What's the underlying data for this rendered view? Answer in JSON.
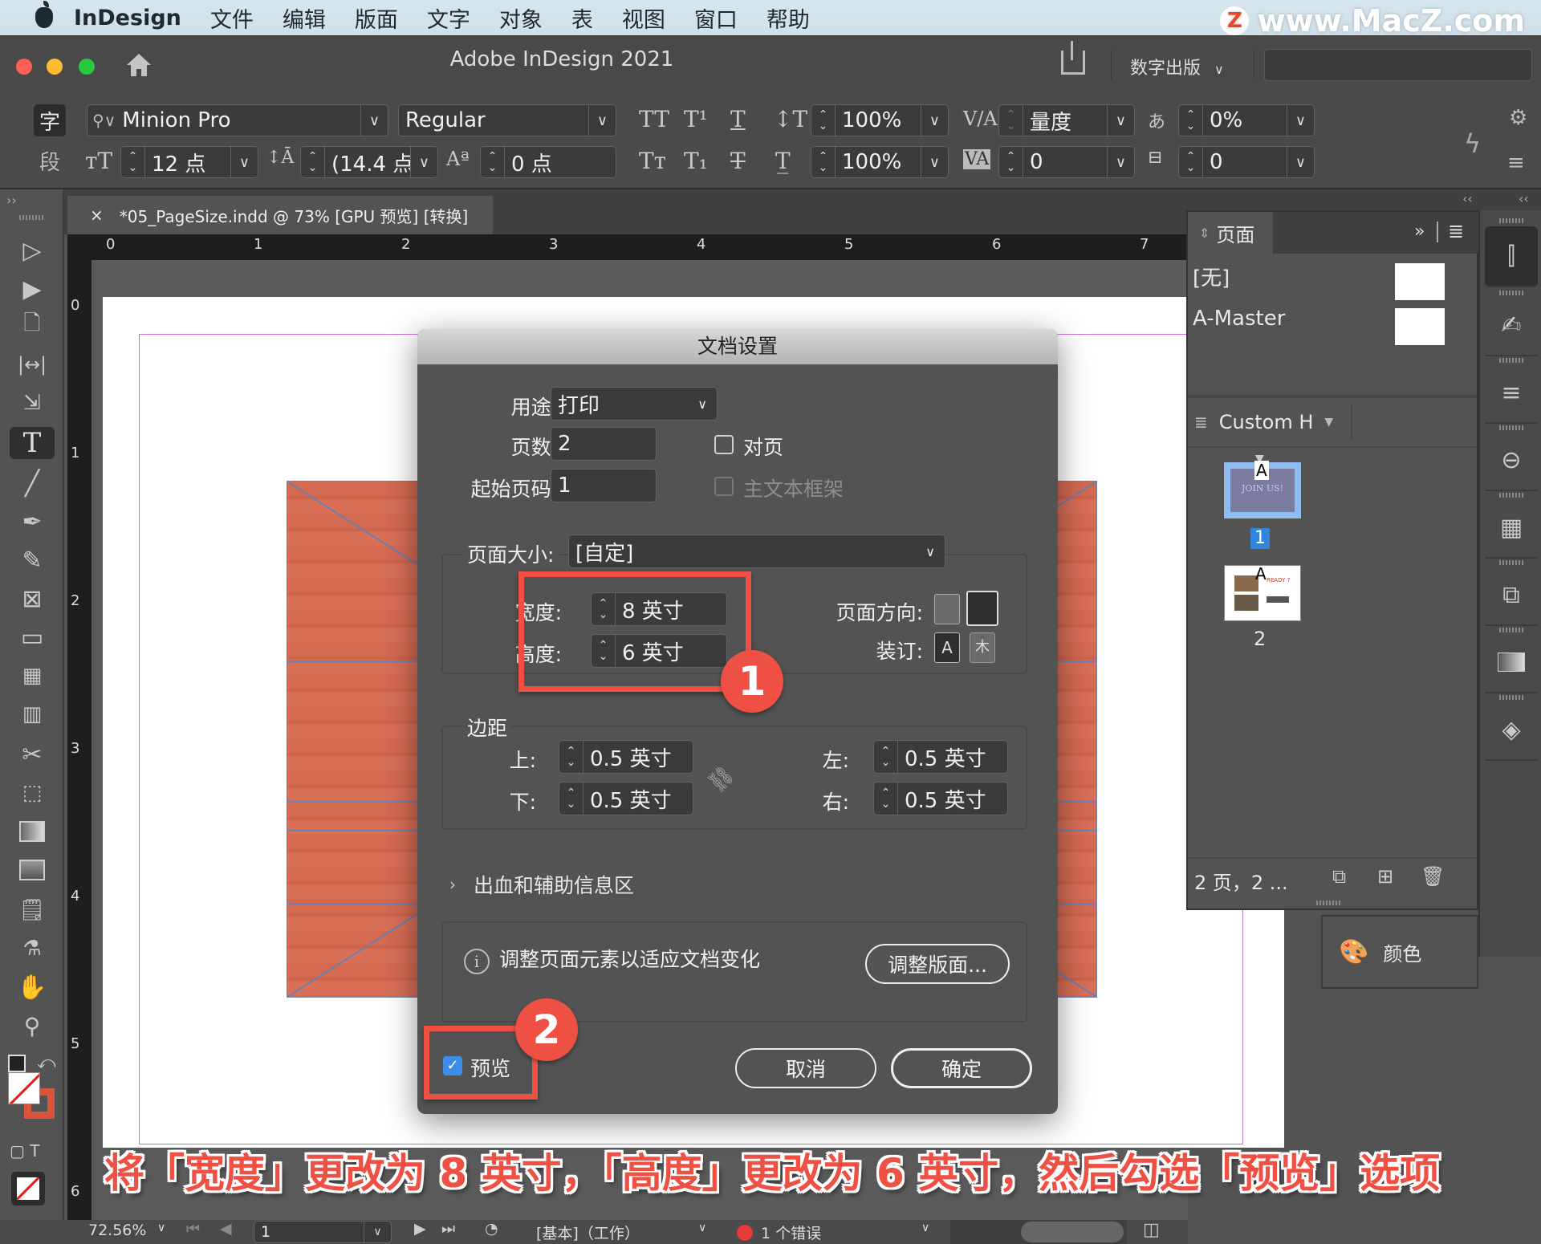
{
  "menubar": {
    "app_name": "InDesign",
    "items": [
      "文件",
      "编辑",
      "版面",
      "文字",
      "对象",
      "表",
      "视图",
      "窗口",
      "帮助"
    ],
    "watermark": "www.MacZ.com",
    "watermark_logo": "Z"
  },
  "window": {
    "title": "Adobe InDesign 2021",
    "workspace": "数字出版",
    "search_placeholder": ""
  },
  "control_panel": {
    "char_mode": "字",
    "para_mode": "段",
    "font_family": "Minion Pro",
    "font_style": "Regular",
    "font_size": "12 点",
    "leading": "(14.4 点",
    "baseline_shift": "0 点",
    "vertical_scale": "100%",
    "horizontal_scale": "100%",
    "kerning": "量度",
    "tracking": "0",
    "tsume": "0%",
    "grid_count": "0"
  },
  "document_tab": {
    "close": "×",
    "title": "*05_PageSize.indd @ 73% [GPU 预览] [转换]"
  },
  "rulers": {
    "horizontal": [
      "0",
      "1",
      "2",
      "3",
      "4",
      "5",
      "6",
      "7"
    ],
    "vertical": [
      "0",
      "1",
      "2",
      "3",
      "4",
      "5",
      "6"
    ]
  },
  "toolbar": {
    "tools": [
      "selection-tool",
      "direct-selection-tool",
      "page-tool",
      "gap-tool",
      "content-collector-tool",
      "type-tool",
      "line-tool",
      "pen-tool",
      "pencil-tool",
      "rectangle-frame-tool",
      "rectangle-tool",
      "table-tool",
      "table-column-tool",
      "scissors-tool",
      "free-transform-tool",
      "gradient-swatch-tool",
      "gradient-feather-tool",
      "note-tool",
      "color-theme-tool",
      "hand-tool",
      "zoom-tool"
    ],
    "selected": "type-tool"
  },
  "dialog": {
    "title": "文档设置",
    "intent_label": "用途:",
    "intent_value": "打印",
    "pages_label": "页数:",
    "pages_value": "2",
    "facing_pages_label": "对页",
    "facing_pages_checked": false,
    "start_page_label": "起始页码:",
    "start_page_value": "1",
    "primary_text_frame_label": "主文本框架",
    "primary_text_frame_checked": false,
    "page_size_label": "页面大小:",
    "page_size_value": "[自定]",
    "width_label": "宽度:",
    "width_value": "8 英寸",
    "height_label": "高度:",
    "height_value": "6 英寸",
    "orientation_label": "页面方向:",
    "orientation_selected": "landscape",
    "binding_label": "装订:",
    "binding_selected": "left-to-right",
    "margins_label": "边距",
    "margin_top_label": "上:",
    "margin_top_value": "0.5 英寸",
    "margin_bottom_label": "下:",
    "margin_bottom_value": "0.5 英寸",
    "margin_left_label": "左:",
    "margin_left_value": "0.5 英寸",
    "margin_right_label": "右:",
    "margin_right_value": "0.5 英寸",
    "bleed_label": "出血和辅助信息区",
    "adjust_info": "调整页面元素以适应文档变化",
    "adjust_button": "调整版面...",
    "preview_label": "预览",
    "preview_checked": true,
    "cancel_button": "取消",
    "ok_button": "确定"
  },
  "annotations": {
    "badge_1": "1",
    "badge_2": "2",
    "caption": "将「宽度」更改为 8 英寸，「高度」更改为 6 英寸，然后勾选「预览」选项",
    "accent_color": "#ef5044"
  },
  "pages_panel": {
    "title": "页面",
    "masters": [
      "[无]",
      "A-Master"
    ],
    "view_label": "Custom H",
    "pages": [
      {
        "number": "1",
        "master": "A",
        "thumb_text": "JOIN US!",
        "selected": true
      },
      {
        "number": "2",
        "master": "A",
        "thumb_text": "READY ?",
        "selected": false
      }
    ],
    "footer_text": "2 页，2 ..."
  },
  "color_panel": {
    "label": "颜色"
  },
  "statusbar": {
    "zoom": "72.56%",
    "page": "1",
    "preflight_profile": "[基本]（工作）",
    "errors": "1 个错误",
    "error_color": "#e83a3a"
  }
}
